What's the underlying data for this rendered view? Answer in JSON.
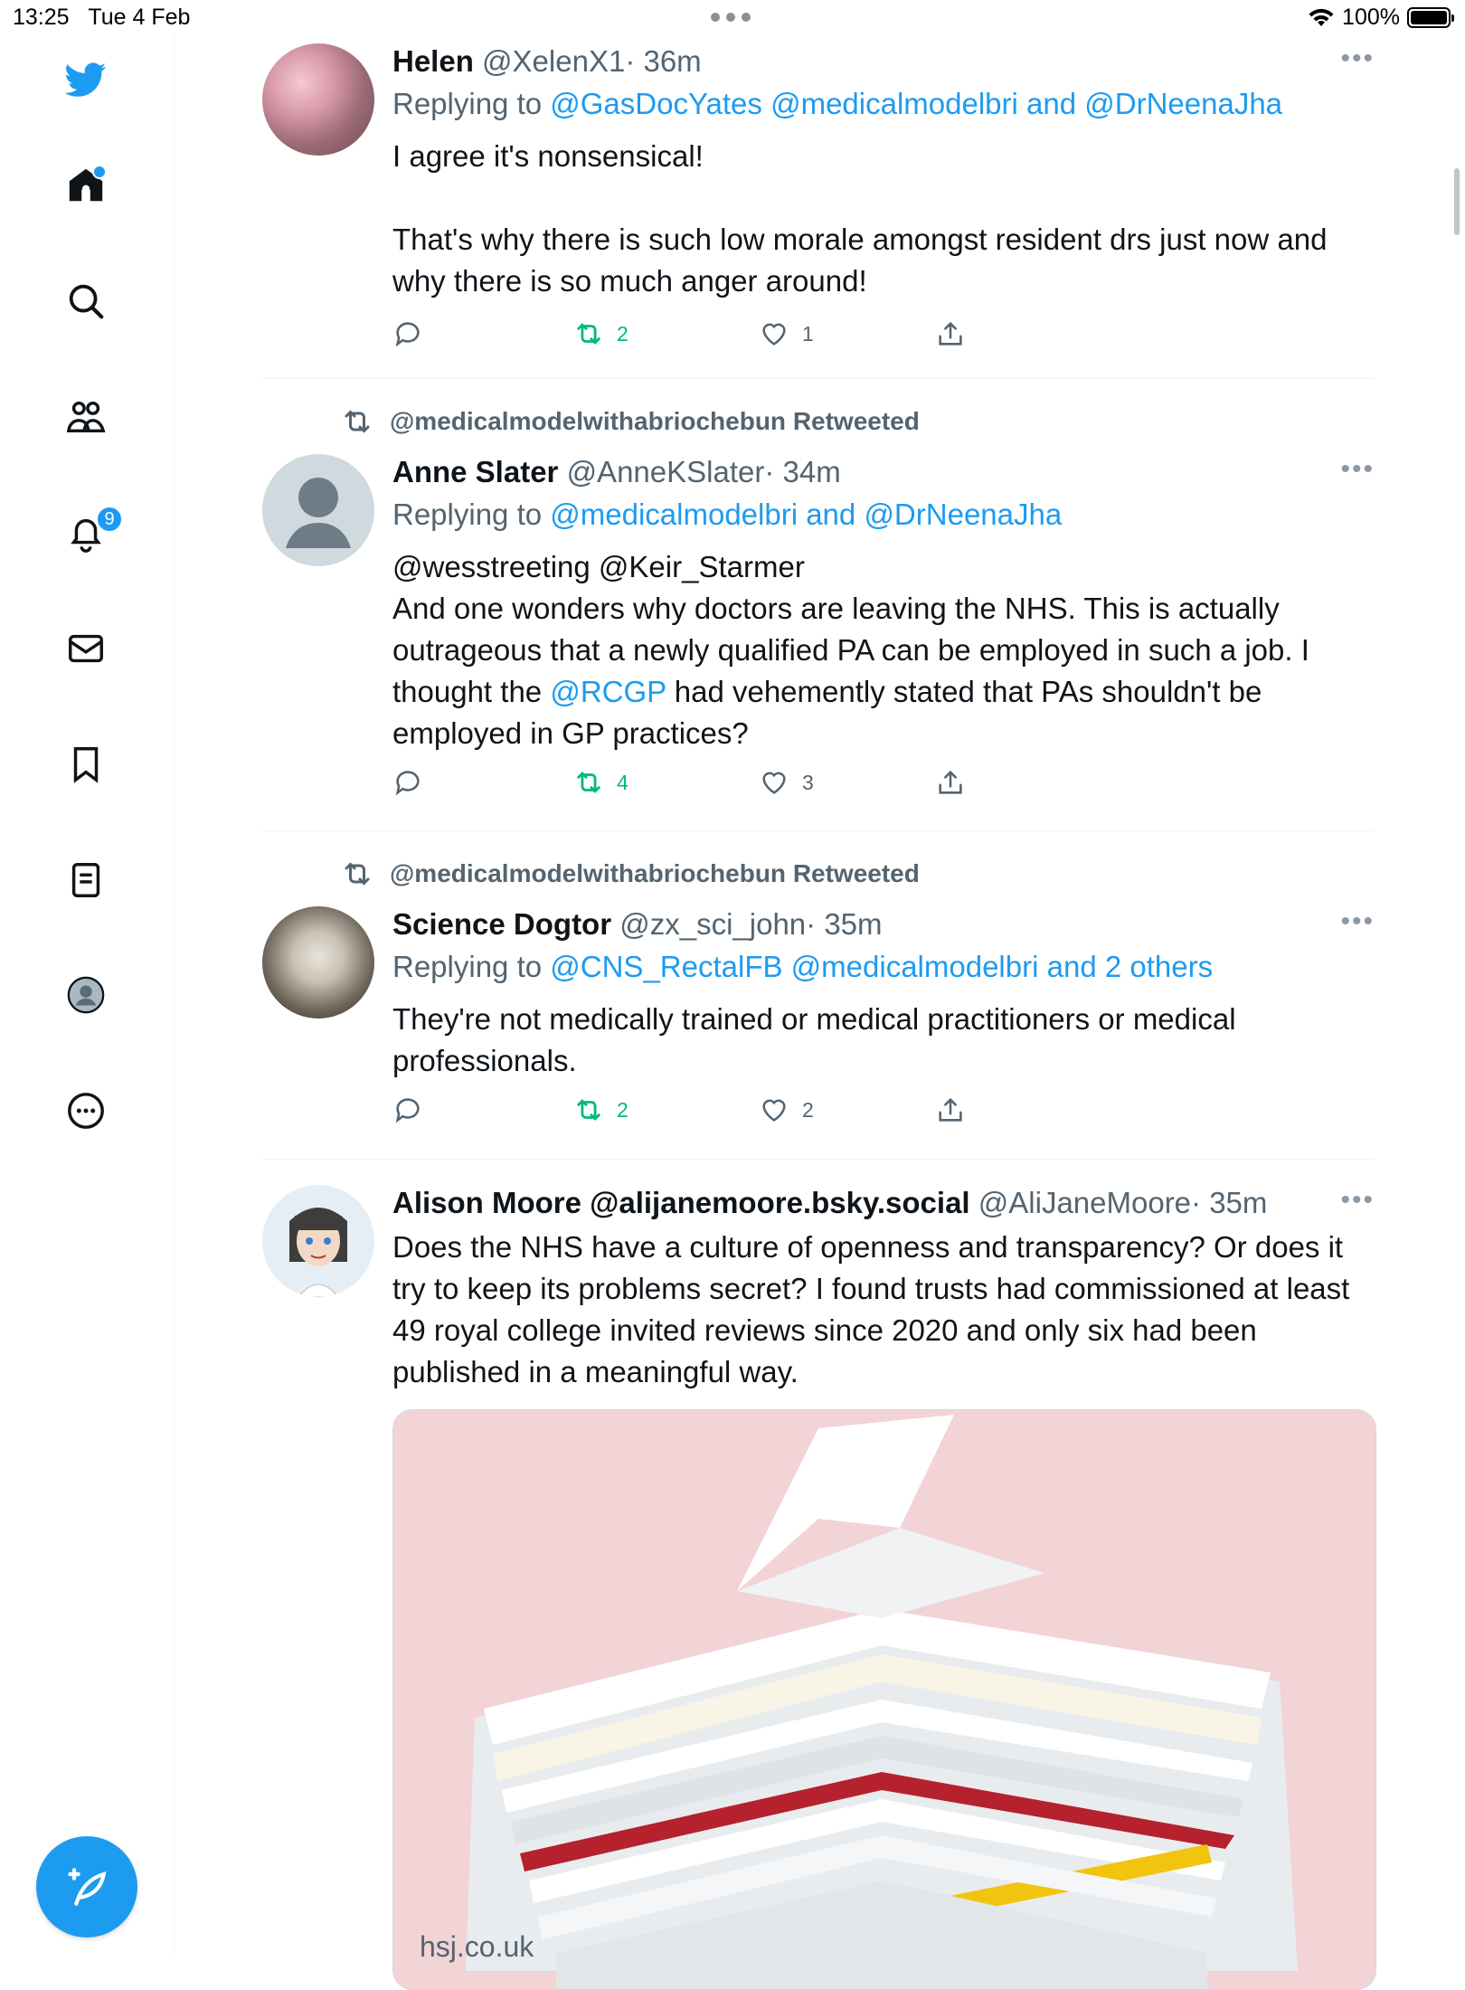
{
  "status_bar": {
    "time": "13:25",
    "date": "Tue 4 Feb",
    "battery": "100%"
  },
  "sidebar": {
    "icons": [
      "twitter-bird-icon",
      "home-icon",
      "search-icon",
      "communities-icon",
      "notifications-icon",
      "messages-icon",
      "bookmarks-icon",
      "lists-icon",
      "profile-icon",
      "more-icon"
    ],
    "notifications_badge": "9",
    "accent": "#1d9bf0"
  },
  "tweets": [
    {
      "name": "Helen",
      "handle": "@XelenX1",
      "time": "· 36m",
      "replying_prefix": "Replying to ",
      "replying_links": [
        "@GasDocYates",
        "@medicalmodelbri",
        "and",
        "@DrNeenaJha"
      ],
      "text_1": "I agree it's nonsensical!",
      "text_2": "That's why there is such low morale amongst resident drs just now and why there is so much anger around!",
      "retweets": "2",
      "likes": "1"
    },
    {
      "retweeted_by": "@medicalmodelwithabriochebun Retweeted",
      "name": "Anne Slater",
      "handle": "@AnneKSlater",
      "time": "· 34m",
      "replying_prefix": "Replying to ",
      "replying_links": [
        "@medicalmodelbri",
        "and",
        "@DrNeenaJha"
      ],
      "mentions": "@wesstreeting @Keir_Starmer",
      "text_before": "And one wonders why doctors are leaving the NHS. This is actually outrageous that a newly qualified PA can be employed in such a job. I thought the ",
      "text_link": "@RCGP",
      "text_after": " had vehemently stated that PAs shouldn't be employed in GP practices?",
      "retweets": "4",
      "likes": "3"
    },
    {
      "retweeted_by": "@medicalmodelwithabriochebun Retweeted",
      "name": "Science Dogtor",
      "handle": "@zx_sci_john",
      "time": "· 35m",
      "replying_prefix": "Replying to ",
      "replying_links": [
        "@CNS_RectalFB",
        "@medicalmodelbri",
        "and 2 others"
      ],
      "text": "They're not medically trained or medical practitioners or medical professionals.",
      "retweets": "2",
      "likes": "2"
    },
    {
      "name": "Alison Moore @alijanemoore.bsky.social",
      "handle": "@AliJaneMoore",
      "time": "· 35m",
      "text": "Does the NHS have a culture of openness and transparency? Or does it try to keep its problems secret? I found  trusts had commissioned at least 49 royal college invited reviews since 2020 and only six had been published in a meaningful way.",
      "media_caption": "hsj.co.uk"
    }
  ]
}
